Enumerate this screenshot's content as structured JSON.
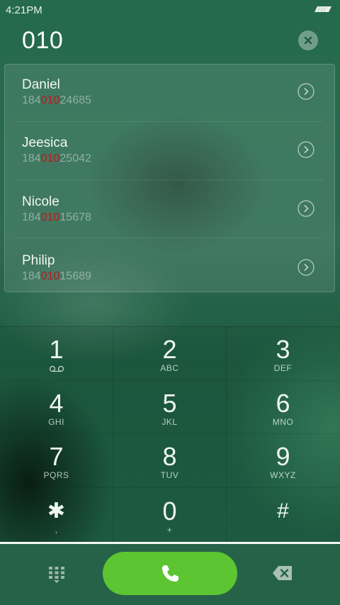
{
  "status_bar": {
    "time": "4:21PM"
  },
  "search": {
    "query": "010"
  },
  "contacts": [
    {
      "name": "Daniel",
      "number_prefix": "184",
      "number_match": "010",
      "number_suffix": "24685"
    },
    {
      "name": "Jeesica",
      "number_prefix": "184",
      "number_match": "010",
      "number_suffix": "25042"
    },
    {
      "name": "Nicole",
      "number_prefix": "184",
      "number_match": "010",
      "number_suffix": "15678"
    },
    {
      "name": "Philip",
      "number_prefix": "184",
      "number_match": "010",
      "number_suffix": "15689"
    }
  ],
  "keypad": [
    {
      "digit": "1",
      "letters": ""
    },
    {
      "digit": "2",
      "letters": "ABC"
    },
    {
      "digit": "3",
      "letters": "DEF"
    },
    {
      "digit": "4",
      "letters": "GHI"
    },
    {
      "digit": "5",
      "letters": "JKL"
    },
    {
      "digit": "6",
      "letters": "MNO"
    },
    {
      "digit": "7",
      "letters": "PQRS"
    },
    {
      "digit": "8",
      "letters": "TUV"
    },
    {
      "digit": "9",
      "letters": "WXYZ"
    },
    {
      "digit": "✱",
      "letters": ","
    },
    {
      "digit": "0",
      "letters": "+"
    },
    {
      "digit": "#",
      "letters": ""
    }
  ],
  "icons": {
    "voicemail": "voicemail-icon",
    "clear": "close-icon",
    "arrow": "chevron-right-icon",
    "dialpad": "dialpad-icon",
    "call": "phone-icon",
    "delete": "backspace-icon",
    "battery": "battery-icon"
  },
  "colors": {
    "call_button": "#5cc531",
    "match_highlight": "#b01e1e",
    "background": "#1f5a42"
  }
}
